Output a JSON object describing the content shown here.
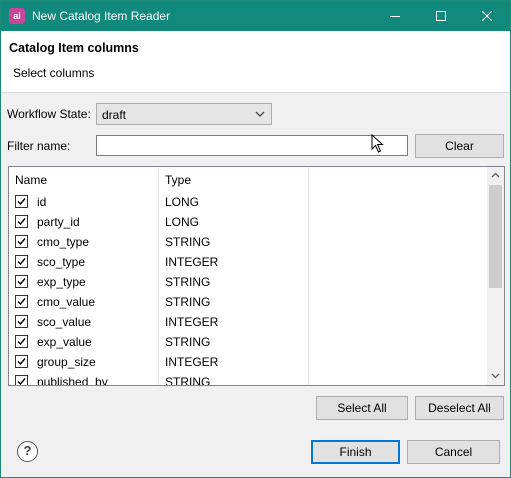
{
  "window": {
    "title": "New Catalog Item Reader",
    "app_icon_text": "ai"
  },
  "header": {
    "title": "Catalog Item columns",
    "subtitle": "Select columns"
  },
  "workflow": {
    "label": "Workflow State:",
    "value": "draft"
  },
  "filter": {
    "label": "Filter name:",
    "value": "",
    "clear_label": "Clear"
  },
  "table": {
    "headers": [
      "Name",
      "Type"
    ],
    "rows": [
      {
        "name": "id",
        "type": "LONG",
        "checked": true
      },
      {
        "name": "party_id",
        "type": "LONG",
        "checked": true
      },
      {
        "name": "cmo_type",
        "type": "STRING",
        "checked": true
      },
      {
        "name": "sco_type",
        "type": "INTEGER",
        "checked": true
      },
      {
        "name": "exp_type",
        "type": "STRING",
        "checked": true
      },
      {
        "name": "cmo_value",
        "type": "STRING",
        "checked": true
      },
      {
        "name": "sco_value",
        "type": "INTEGER",
        "checked": true
      },
      {
        "name": "exp_value",
        "type": "STRING",
        "checked": true
      },
      {
        "name": "group_size",
        "type": "INTEGER",
        "checked": true
      },
      {
        "name": "published_by",
        "type": "STRING",
        "checked": true
      }
    ]
  },
  "actions": {
    "select_all": "Select All",
    "deselect_all": "Deselect All"
  },
  "footer": {
    "help_icon": "?",
    "finish_label": "Finish",
    "cancel_label": "Cancel"
  },
  "colors": {
    "titlebar": "#12897d",
    "default_button_border": "#0078d7"
  }
}
